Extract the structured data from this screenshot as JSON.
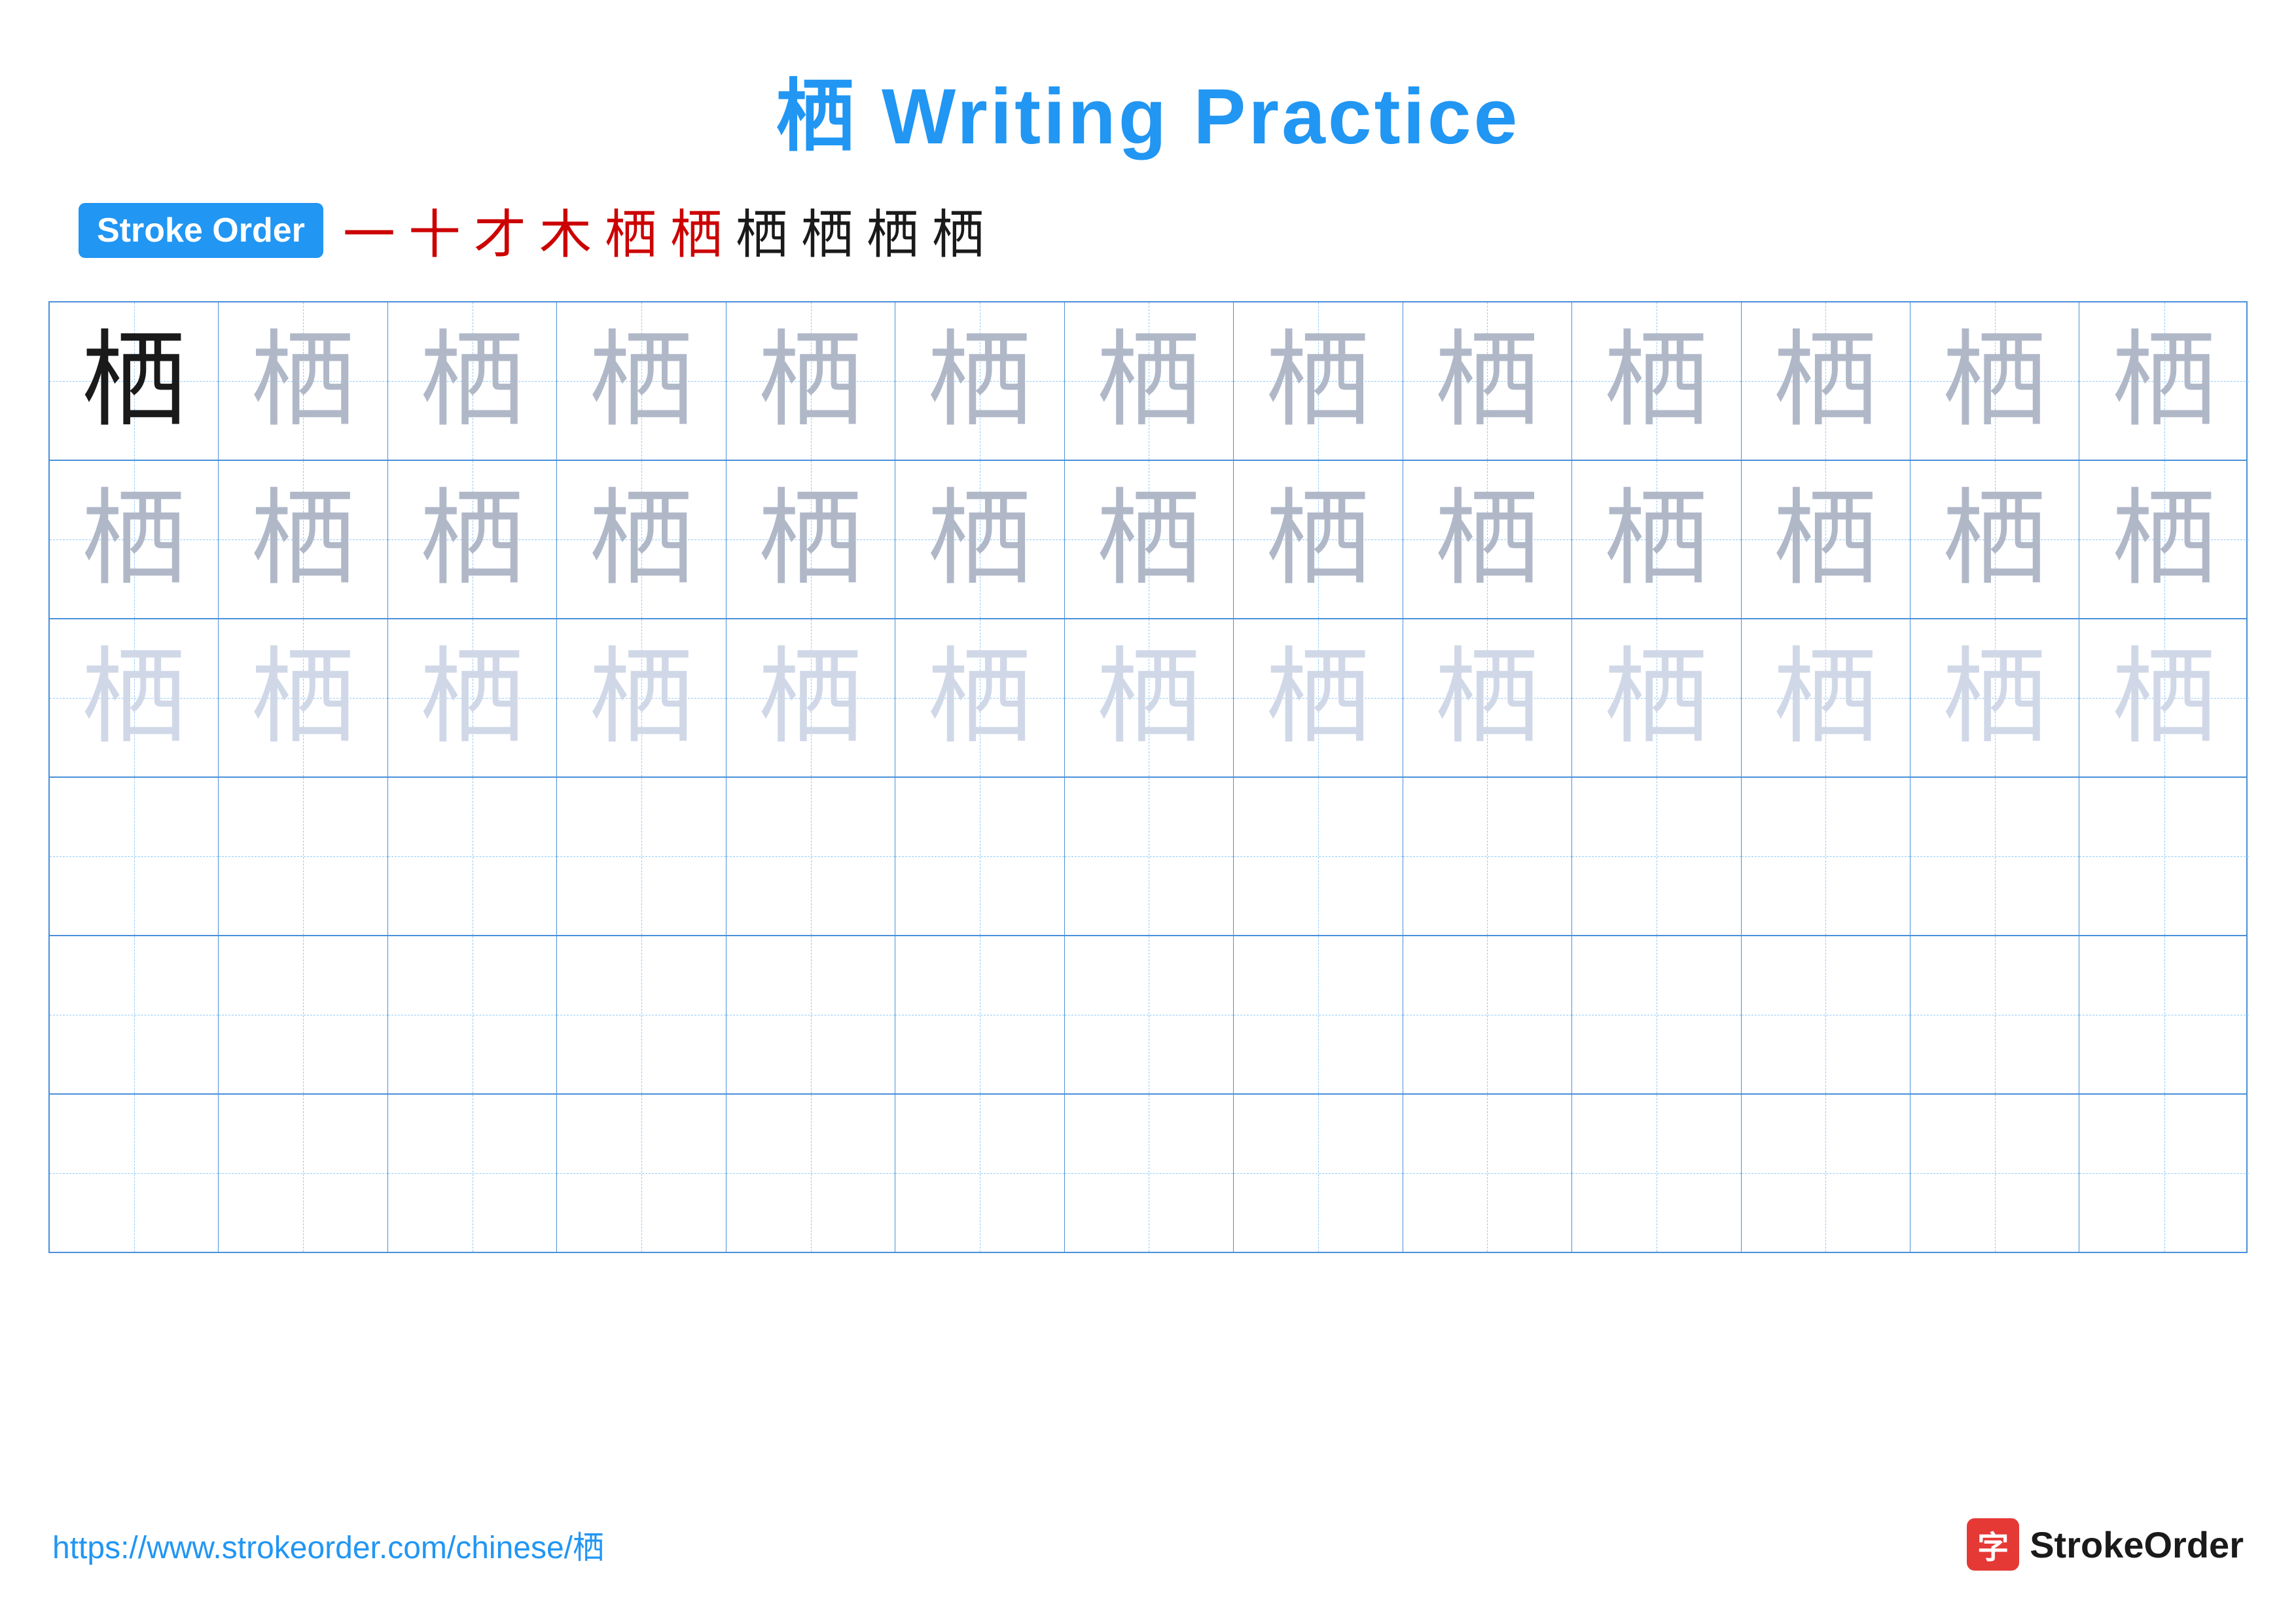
{
  "title": "栖 Writing Practice",
  "stroke_order_badge": "Stroke Order",
  "stroke_sequence": [
    "一",
    "十",
    "才",
    "木",
    "栖",
    "栖",
    "栖",
    "栖",
    "栖",
    "栖"
  ],
  "character": "栖",
  "rows": [
    {
      "type": "dark_then_medium",
      "first_dark": true
    },
    {
      "type": "medium"
    },
    {
      "type": "light"
    },
    {
      "type": "empty"
    },
    {
      "type": "empty"
    },
    {
      "type": "empty"
    }
  ],
  "footer": {
    "url": "https://www.strokeorder.com/chinese/栖",
    "logo_char": "字",
    "logo_text": "StrokeOrder"
  },
  "colors": {
    "blue": "#2196F3",
    "red": "#cc0000",
    "dark_char": "#1a1a1a",
    "medium_char": "#b0b8c8",
    "light_char": "#d0d8e8",
    "grid_border": "#4a90d9",
    "grid_dashed": "#90caf9"
  }
}
